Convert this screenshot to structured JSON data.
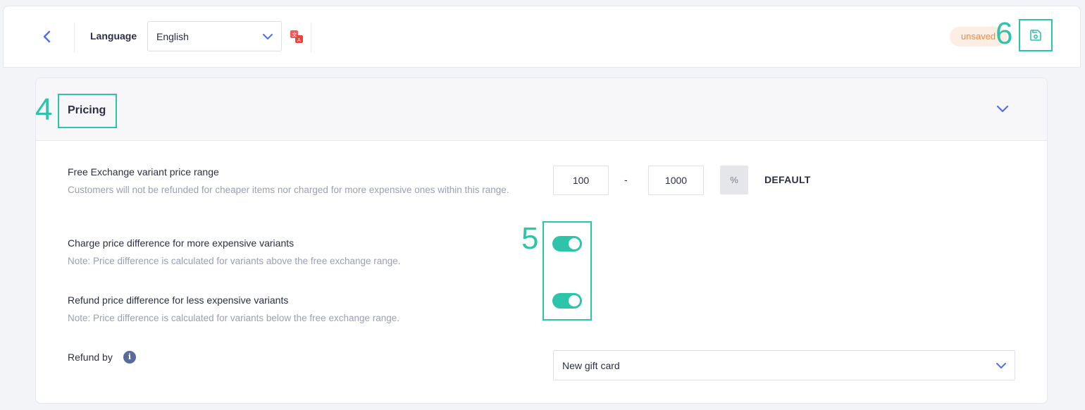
{
  "header": {
    "language_label": "Language",
    "language_value": "English",
    "status_badge": "unsaved",
    "annotation_save": "6"
  },
  "pricing": {
    "title": "Pricing",
    "annotation_title": "4",
    "price_range": {
      "label": "Free Exchange variant price range",
      "note": "Customers will not be refunded for cheaper items nor charged for more expensive ones within this range.",
      "min": "100",
      "separator": "-",
      "max": "1000",
      "unit": "%",
      "default_label": "DEFAULT"
    },
    "annotation_toggles": "5",
    "charge_difference": {
      "label": "Charge price difference for more expensive variants",
      "note": "Note: Price difference is calculated for variants above the free exchange range.",
      "enabled": true
    },
    "refund_difference": {
      "label": "Refund price difference for less expensive variants",
      "note": "Note: Price difference is calculated for variants below the free exchange range.",
      "enabled": true
    },
    "refund_by": {
      "label": "Refund by",
      "info_icon": "i",
      "value": "New gift card"
    }
  },
  "colors": {
    "accent": "#4f6ef7",
    "annotation": "#2ec4a9",
    "toggle_on": "#2ec4a9",
    "badge_bg": "#fdeee3",
    "badge_text": "#f08a3c"
  }
}
